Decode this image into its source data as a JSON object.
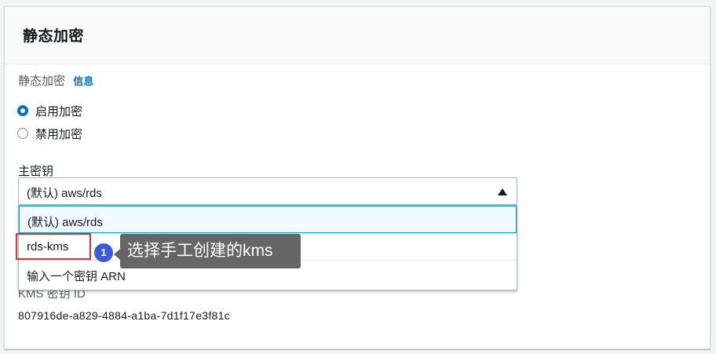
{
  "section": {
    "title": "静态加密"
  },
  "encryption": {
    "label": "静态加密",
    "info_link": "信息",
    "options": [
      {
        "label": "启用加密",
        "selected": true
      },
      {
        "label": "禁用加密",
        "selected": false
      }
    ]
  },
  "master_key": {
    "label": "主密钥",
    "selected_value": "(默认) aws/rds",
    "dropdown_options": [
      {
        "label": "(默认) aws/rds",
        "highlighted": true
      },
      {
        "label": "rds-kms",
        "highlighted": false
      },
      {
        "label": "输入一个密钥 ARN",
        "highlighted": false
      }
    ]
  },
  "annotation": {
    "step_number": "1",
    "text": "选择手工创建的kms"
  },
  "kms_key_id": {
    "label": "KMS 密钥 ID",
    "value": "807916de-a829-4884-a1ba-7d1f17e3f81c"
  },
  "colors": {
    "accent": "#0073bb",
    "selected_option_bg": "#f1faff",
    "highlight_border": "#e03131",
    "badge": "#3b5bdb",
    "tooltip_bg": "#666666"
  }
}
